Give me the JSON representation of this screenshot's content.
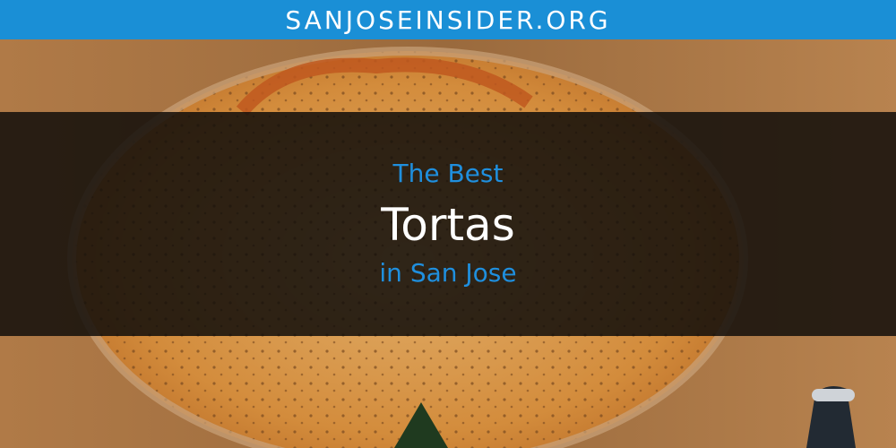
{
  "header": {
    "site_name": "SANJOSEINSIDER.ORG"
  },
  "banner": {
    "title_prefix": "The Best",
    "title_main": "Tortas",
    "title_suffix": "in San Jose"
  },
  "colors": {
    "header_bg": "#1a8fd6",
    "accent_text": "#1f8fde",
    "main_text": "#ffffff",
    "overlay": "#120e0a"
  }
}
